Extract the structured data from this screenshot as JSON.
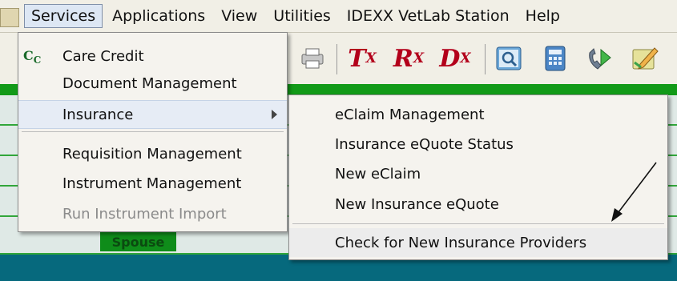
{
  "menubar": {
    "items": [
      "Services",
      "Applications",
      "View",
      "Utilities",
      "IDEXX VetLab Station",
      "Help"
    ]
  },
  "toolbar": {
    "tx": "T",
    "tx_sub": "X",
    "rx": "R",
    "rx_sub": "X",
    "dx": "D",
    "dx_sub": "X"
  },
  "background": {
    "spouse_label": "Spouse"
  },
  "services_menu": {
    "items": [
      {
        "label": "Care Credit",
        "icon": "care-credit-icon"
      },
      {
        "label": "Document Management"
      },
      {
        "label": "Insurance",
        "has_submenu": true
      },
      {
        "label": "Requisition Management"
      },
      {
        "label": "Instrument Management"
      },
      {
        "label": "Run Instrument Import",
        "disabled": true
      }
    ]
  },
  "insurance_menu": {
    "items": [
      {
        "label": "eClaim Management"
      },
      {
        "label": "Insurance eQuote Status"
      },
      {
        "label": "New eClaim"
      },
      {
        "label": "New Insurance eQuote"
      },
      {
        "label": "Check for New Insurance Providers"
      }
    ]
  },
  "colors": {
    "menu_bg": "#f5f3ee",
    "toolbar_text": "#b3001b",
    "green": "#129a18",
    "teal": "#06697d"
  }
}
